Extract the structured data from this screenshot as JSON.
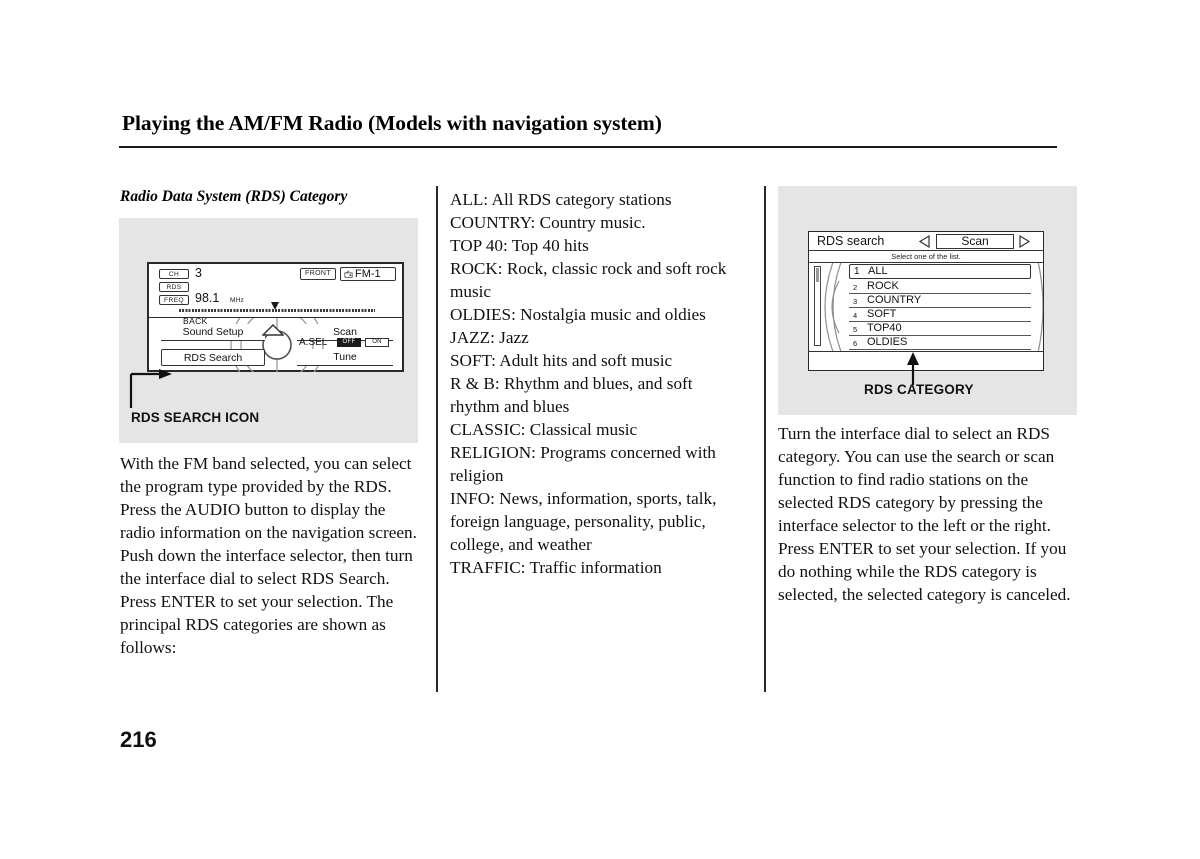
{
  "header": {
    "title": "Playing the AM/FM Radio (Models with navigation system)"
  },
  "page_number": "216",
  "left_column": {
    "subtitle": "Radio Data System (RDS) Category",
    "figure": {
      "caption": "RDS SEARCH ICON",
      "radio": {
        "badge_ch": "CH",
        "badge_rds": "RDS",
        "badge_freq": "FREQ",
        "channel_value": "3",
        "freq_value": "98.1",
        "freq_unit": "MHz",
        "front_label": "FRONT",
        "band_label": "FM-1",
        "back_label": "BACK",
        "btn_sound_setup": "Sound Setup",
        "btn_scan": "Scan",
        "btn_rds_search": "RDS Search",
        "btn_tune": "Tune",
        "asel_label": "A.SEL",
        "asel_off": "OFF",
        "asel_on": "ON"
      }
    },
    "body": "With the FM band selected, you can select the program type provided by the RDS. Press the AUDIO button to display the radio information on the navigation screen. Push down the interface selector, then turn the interface dial to select RDS Search. Press ENTER to set your selection. The principal RDS categories are shown as follows:"
  },
  "middle_column": {
    "body": "ALL: All RDS category stations\nCOUNTRY: Country music.\nTOP 40: Top 40 hits\nROCK: Rock, classic rock and soft rock music\nOLDIES: Nostalgia music and oldies\nJAZZ: Jazz\nSOFT: Adult hits and soft music\nR & B: Rhythm and blues, and soft rhythm and blues\nCLASSIC: Classical music\nRELIGION: Programs concerned with religion\nINFO: News, information, sports, talk, foreign language, personality, public, college, and weather\nTRAFFIC: Traffic information",
    "categories": [
      {
        "name": "ALL",
        "description": "All RDS category stations"
      },
      {
        "name": "COUNTRY",
        "description": "Country music."
      },
      {
        "name": "TOP 40",
        "description": "Top 40 hits"
      },
      {
        "name": "ROCK",
        "description": "Rock, classic rock and soft rock music"
      },
      {
        "name": "OLDIES",
        "description": "Nostalgia music and oldies"
      },
      {
        "name": "JAZZ",
        "description": "Jazz"
      },
      {
        "name": "SOFT",
        "description": "Adult hits and soft music"
      },
      {
        "name": "R & B",
        "description": "Rhythm and blues, and soft rhythm and blues"
      },
      {
        "name": "CLASSIC",
        "description": "Classical music"
      },
      {
        "name": "RELIGION",
        "description": "Programs concerned with religion"
      },
      {
        "name": "INFO",
        "description": "News, information, sports, talk, foreign language, personality, public, college, and weather"
      },
      {
        "name": "TRAFFIC",
        "description": "Traffic information"
      }
    ]
  },
  "right_column": {
    "figure": {
      "caption": "RDS CATEGORY",
      "nav_screen": {
        "title": "RDS search",
        "scan_button": "Scan",
        "hint": "Select one of the list.",
        "list": [
          {
            "num": "1",
            "label": "ALL"
          },
          {
            "num": "2",
            "label": "ROCK"
          },
          {
            "num": "3",
            "label": "COUNTRY"
          },
          {
            "num": "4",
            "label": "SOFT"
          },
          {
            "num": "5",
            "label": "TOP40"
          },
          {
            "num": "6",
            "label": "OLDIES"
          }
        ]
      }
    },
    "body": "Turn the interface dial to select an RDS category. You can use the search or scan function to find radio stations on the selected RDS category by pressing the interface selector to the left or the right. Press ENTER to set your selection. If you do nothing while the RDS category is selected, the selected category is canceled."
  },
  "colors": {
    "page_background": "#ffffff",
    "figure_background": "#e5e5e5",
    "rule": "#1a1a1a",
    "text": "#111111"
  }
}
